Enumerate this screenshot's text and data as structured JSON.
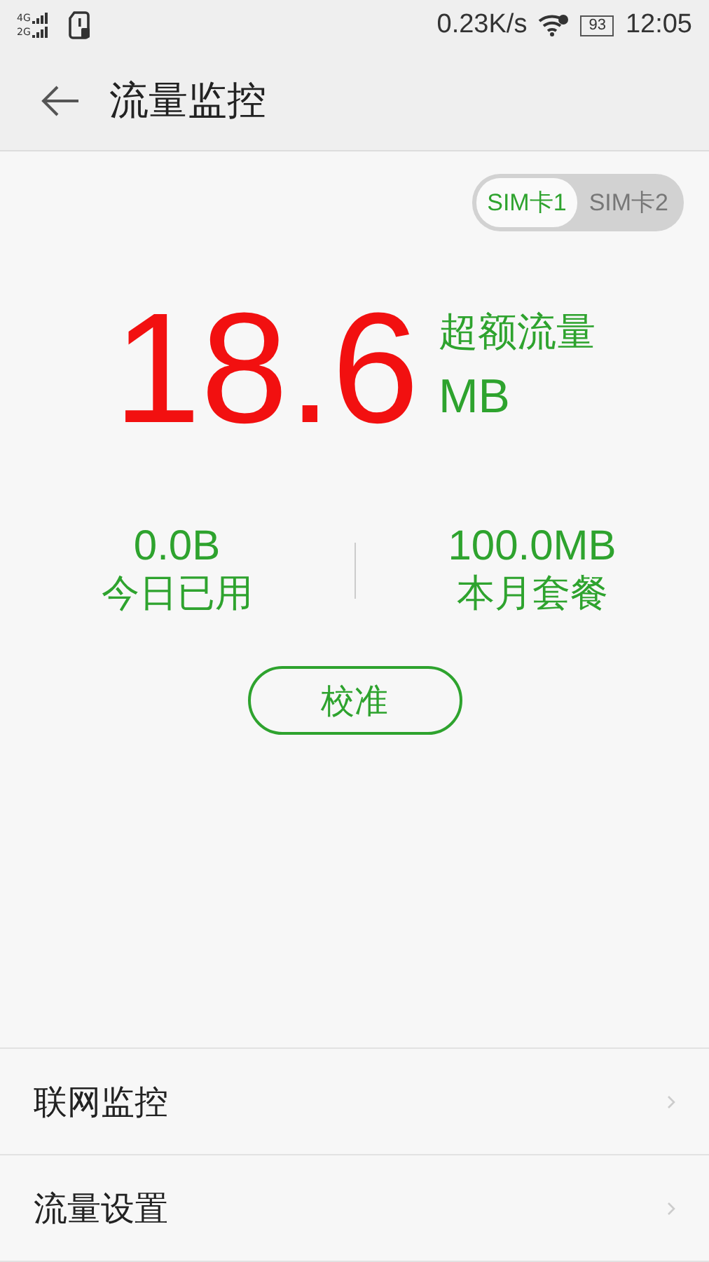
{
  "status_bar": {
    "network_1": "4G",
    "network_2": "2G",
    "speed": "0.23K/s",
    "battery": "93",
    "time": "12:05"
  },
  "header": {
    "title": "流量监控"
  },
  "sim_tabs": [
    {
      "label": "SIM卡1",
      "selected": true
    },
    {
      "label": "SIM卡2",
      "selected": false
    }
  ],
  "usage": {
    "value": "18.6",
    "label": "超额流量",
    "unit": "MB"
  },
  "stats": [
    {
      "value": "0.0B",
      "label": "今日已用"
    },
    {
      "value": "100.0MB",
      "label": "本月套餐"
    }
  ],
  "calibrate_button": "校准",
  "menu": [
    {
      "label": "联网监控"
    },
    {
      "label": "流量设置"
    }
  ]
}
